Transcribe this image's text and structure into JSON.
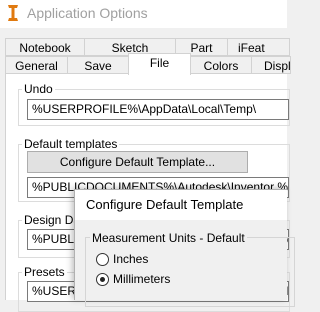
{
  "window": {
    "title": "Application Options"
  },
  "tabs": {
    "row1": [
      "Notebook",
      "Sketch",
      "Part",
      "iFeat"
    ],
    "row2": [
      "General",
      "Save",
      "File",
      "Colors",
      "Displ"
    ]
  },
  "undo": {
    "label": "Undo",
    "path": "%USERPROFILE%\\AppData\\Local\\Temp\\"
  },
  "default_templates": {
    "label": "Default templates",
    "button": "Configure Default Template...",
    "path": "%PUBLICDOCUMENTS%\\Autodesk\\Inventor %RELEASE%\\Templates\\"
  },
  "design_data": {
    "label": "Design Data",
    "path": "%PUBLICDOCUMENTS%\\Autodesk\\Inventor %RELEASE%\\Design Data\\"
  },
  "presets": {
    "label": "Presets",
    "path": "%USERPROFILE%\\AppData\\Roaming\\Autodesk\\Inventor\\"
  },
  "dialog": {
    "title": "Configure Default Template",
    "units_group": "Measurement Units - Default",
    "options": [
      {
        "label": "Inches",
        "selected": false
      },
      {
        "label": "Millimeters",
        "selected": true
      }
    ]
  },
  "colors": {
    "icon_orange": "#e07a10",
    "window_bg": "#f0f0f0"
  }
}
